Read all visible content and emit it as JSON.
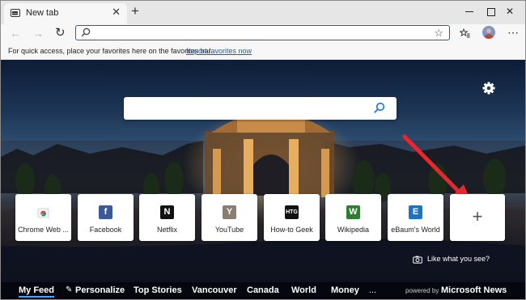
{
  "tab": {
    "title": "New tab",
    "close": "✕",
    "new": "+"
  },
  "window": {
    "close": "✕"
  },
  "nav": {
    "back": "←",
    "forward": "→",
    "refresh": "↻"
  },
  "address": {
    "value": "",
    "placeholder": ""
  },
  "toolbar": {
    "favorites": "☆",
    "more": "⋯"
  },
  "favorites_bar": {
    "message": "For quick access, place your favorites here on the favorites bar.",
    "link": "Import favorites now"
  },
  "search": {
    "placeholder": ""
  },
  "tiles": [
    {
      "label": "Chrome Web ...",
      "glyph": "",
      "color": "#ffffff"
    },
    {
      "label": "Facebook",
      "glyph": "f",
      "color": "#3b5998"
    },
    {
      "label": "Netflix",
      "glyph": "N",
      "color": "#111111"
    },
    {
      "label": "YouTube",
      "glyph": "Y",
      "color": "#8a7d72"
    },
    {
      "label": "How-to Geek",
      "glyph": "HTG",
      "color": "#111111"
    },
    {
      "label": "Wikipedia",
      "glyph": "W",
      "color": "#2e7d32"
    },
    {
      "label": "eBaum's World",
      "glyph": "E",
      "color": "#1e73be"
    }
  ],
  "add_tile": "+",
  "like": "Like what you see?",
  "news_nav": [
    {
      "label": "My Feed",
      "active": true
    },
    {
      "label": "Personalize"
    },
    {
      "label": "Top Stories"
    },
    {
      "label": "Vancouver"
    },
    {
      "label": "Canada"
    },
    {
      "label": "World"
    },
    {
      "label": "Money"
    },
    {
      "label": "..."
    }
  ],
  "powered_by": "powered by",
  "provider": "Microsoft News",
  "colors": {
    "accent": "#0b63c5",
    "arrow": "#e8262d",
    "underline": "#4ca0ff"
  }
}
